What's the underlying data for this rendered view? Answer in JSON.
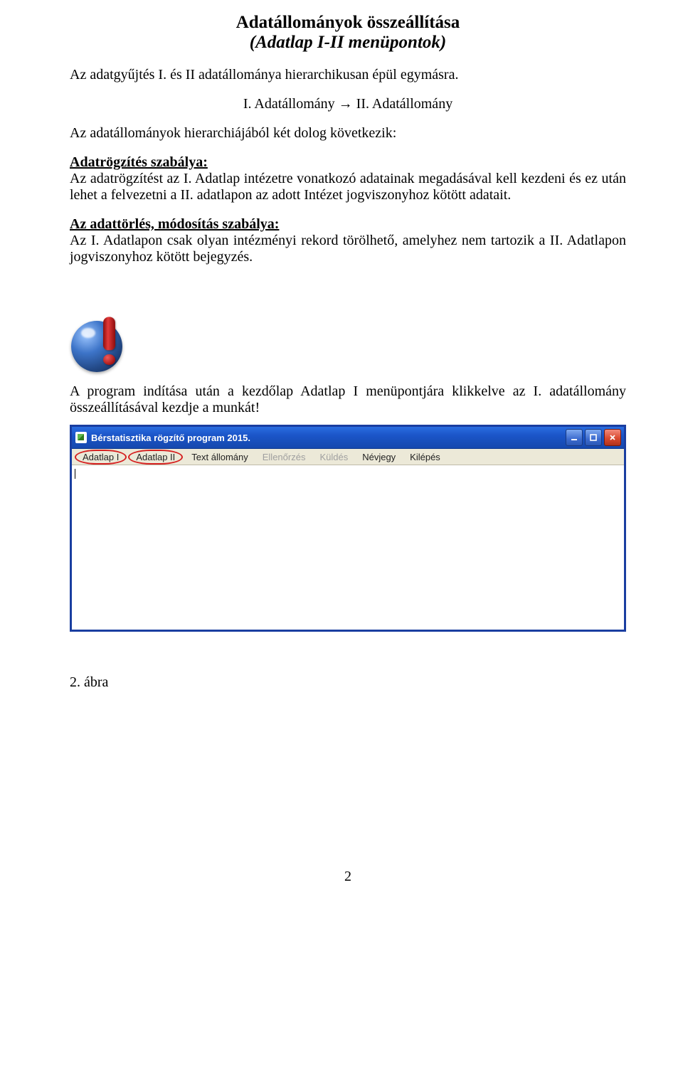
{
  "title": "Adatállományok összeállítása",
  "subtitle": "(Adatlap I-II menüpontok)",
  "para_intro": "Az adatgyűjtés I. és II adatállománya hierarchikusan épül egymásra.",
  "para_chain": "I. Adatállomány → II. Adatállomány",
  "para_hier_lead": "Az adatállományok hierarchiájából két dolog következik:",
  "rule1_heading": "Adatrögzítés szabálya:",
  "rule1_body": "Az adatrögzítést az I. Adatlap intézetre vonatkozó adatainak megadásával kell kezdeni és ez után lehet a felvezetni a II. adatlapon az adott Intézet jogviszonyhoz kötött adatait.",
  "rule2_heading": "Az adattörlés, módosítás szabálya:",
  "rule2_body": "Az I. Adatlapon csak olyan intézményi rekord törölhető, amelyhez nem tartozik a II. Adatlapon jogviszonyhoz kötött bejegyzés.",
  "callout_text": "A program indítása után a kezdőlap Adatlap I menüpontjára klikkelve az I. adatállomány összeállításával kezdje a munkát!",
  "window": {
    "title": "Bérstatisztika rögzítő program 2015.",
    "menu": {
      "adatlap1": "Adatlap I",
      "adatlap2": "Adatlap II",
      "text_allomany": "Text állomány",
      "ellenorzes": "Ellenőrzés",
      "kuldes": "Küldés",
      "nevjegy": "Névjegy",
      "kilepes": "Kilépés"
    }
  },
  "figure_caption": "2. ábra",
  "page_number": "2"
}
